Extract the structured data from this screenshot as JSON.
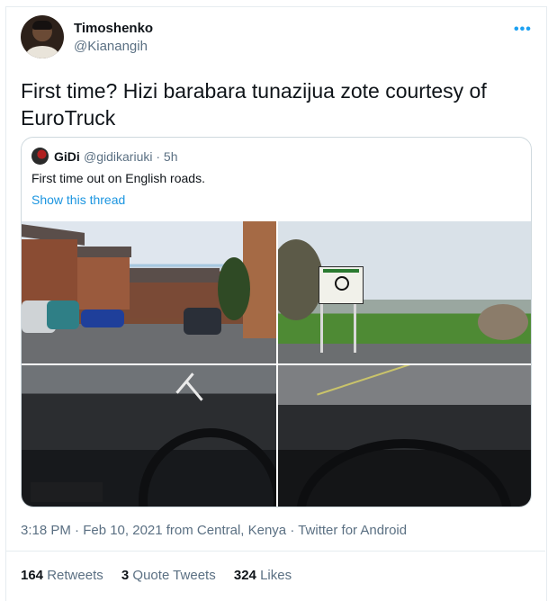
{
  "tweet": {
    "display_name": "Timoshenko",
    "handle": "@Kianangih",
    "more_icon": "more-dots-icon",
    "text": "First time? Hizi barabara tunazijua zote courtesy of EuroTruck",
    "meta": "3:18 PM · Feb 10, 2021 from Central, Kenya · Twitter for Android"
  },
  "quote": {
    "display_name": "GiDi",
    "handle_time": "@gidikariuki · 5h",
    "text": "First time out on English roads.",
    "link": "Show this thread"
  },
  "stats": {
    "retweets_count": "164",
    "retweets_label": "Retweets",
    "quotes_count": "3",
    "quotes_label": "Quote Tweets",
    "likes_count": "324",
    "likes_label": "Likes"
  },
  "colors": {
    "link": "#1b95e0",
    "more": "#1da1f2",
    "muted": "#5b7083"
  }
}
